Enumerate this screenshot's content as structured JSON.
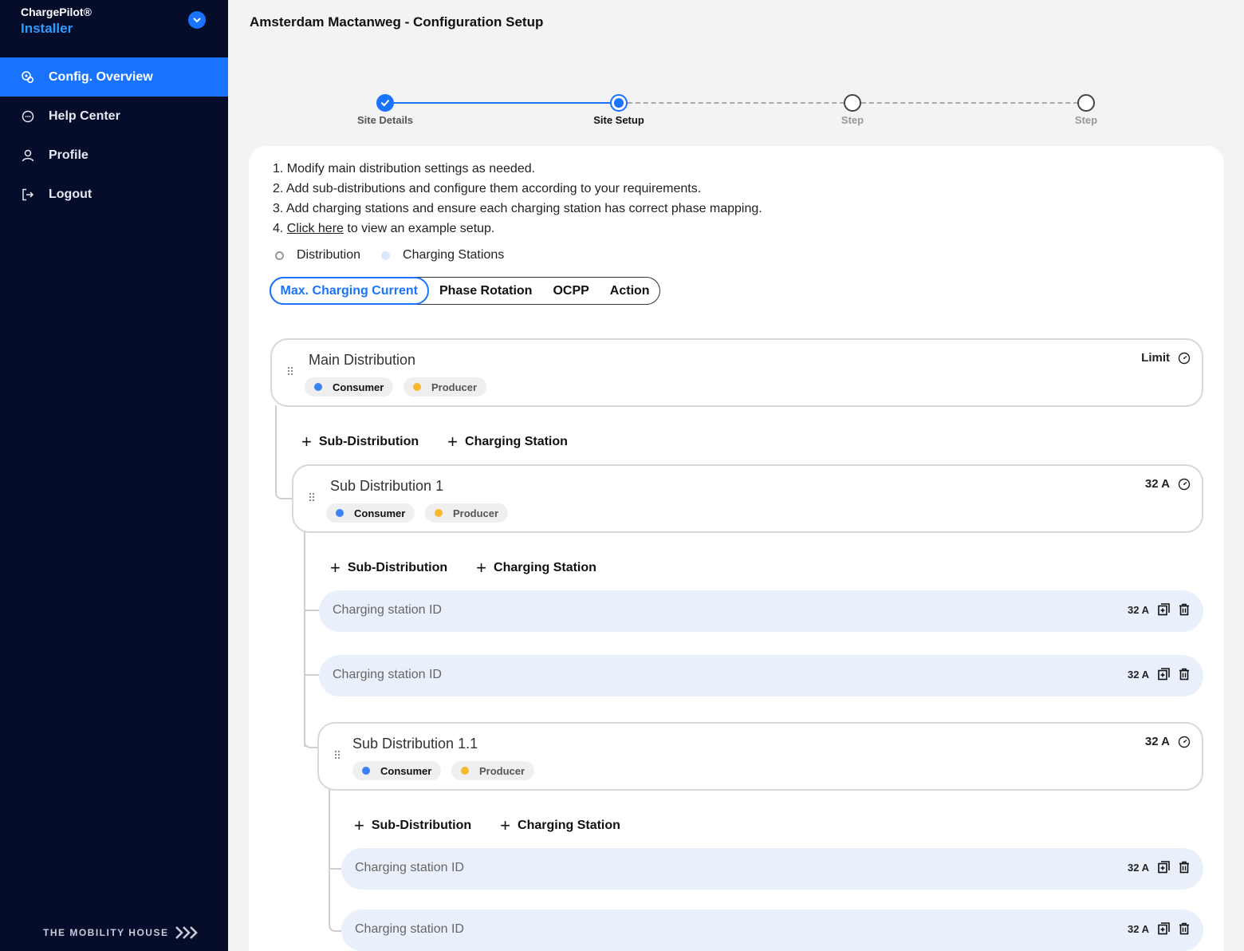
{
  "app": {
    "brand_line1": "ChargePilot®",
    "brand_line2": "Installer"
  },
  "sidebar": {
    "items": [
      {
        "label": "Config. Overview",
        "icon": "config-icon",
        "active": true
      },
      {
        "label": "Help Center",
        "icon": "chat-icon",
        "active": false
      },
      {
        "label": "Profile",
        "icon": "user-icon",
        "active": false
      },
      {
        "label": "Logout",
        "icon": "logout-icon",
        "active": false
      }
    ],
    "footer": "THE MOBILITY HOUSE"
  },
  "page": {
    "title": "Amsterdam Mactanweg - Configuration Setup"
  },
  "stepper": {
    "steps": [
      {
        "label": "Site Details",
        "state": "done"
      },
      {
        "label": "Site Setup",
        "state": "current"
      },
      {
        "label": "Step",
        "state": "future"
      },
      {
        "label": "Step",
        "state": "future"
      }
    ]
  },
  "instructions": {
    "line1": "1. Modify main distribution settings as needed.",
    "line2": "2. Add sub-distributions and configure them according to your requirements.",
    "line3": "3. Add charging stations and ensure each charging station has correct phase mapping.",
    "line4_prefix": "4. ",
    "line4_link": "Click here",
    "line4_suffix": " to view an example setup."
  },
  "legend": {
    "distribution": "Distribution",
    "charging_stations": "Charging Stations"
  },
  "tabs": {
    "max_current": "Max. Charging Current",
    "phase_rotation": "Phase Rotation",
    "ocpp": "OCPP",
    "action": "Action"
  },
  "tree": {
    "consumer": "Consumer",
    "producer": "Producer",
    "add_sub": "Sub-Distribution",
    "add_cs": "Charging Station",
    "main": {
      "title": "Main Distribution",
      "right": "Limit"
    },
    "sub1": {
      "title": "Sub Distribution 1",
      "right": "32 A"
    },
    "sub11": {
      "title": "Sub Distribution 1.1",
      "right": "32 A"
    },
    "cs_label": "Charging station ID",
    "cs_current": "32 A"
  },
  "colors": {
    "accent": "#1a73ff",
    "sidebar": "#050d2b",
    "consumer": "#3b82f6",
    "producer": "#f5b82e",
    "cs_bg": "#e9f0fb"
  }
}
